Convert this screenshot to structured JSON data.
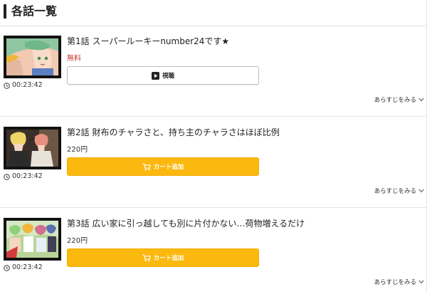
{
  "section": {
    "title": "各話一覧"
  },
  "episodes": [
    {
      "title": "第1話 スーパールーキーnumber24です★",
      "price": "無料",
      "duration": "00:23:42",
      "button_label": "視聴",
      "button_type": "watch",
      "synopsis_label": "あらすじをみる",
      "thumb_icon": "anime-thumbnail-green-haired-boy"
    },
    {
      "title": "第2話 財布のチャラさと、持ち主のチャラさはほぼ比例",
      "price": "220円",
      "duration": "00:23:42",
      "button_label": "カート追加",
      "button_type": "cart",
      "synopsis_label": "あらすじをみる",
      "thumb_icon": "anime-thumbnail-two-characters"
    },
    {
      "title": "第3話 広い家に引っ越しても別に片付かない…荷物増えるだけ",
      "price": "220円",
      "duration": "00:23:42",
      "button_label": "カート追加",
      "button_type": "cart",
      "synopsis_label": "あらすじをみる",
      "thumb_icon": "anime-thumbnail-group"
    }
  ],
  "colors": {
    "cart_button": "#fbb80e",
    "free_price": "#c0392b",
    "divider": "#e2e2e2"
  }
}
